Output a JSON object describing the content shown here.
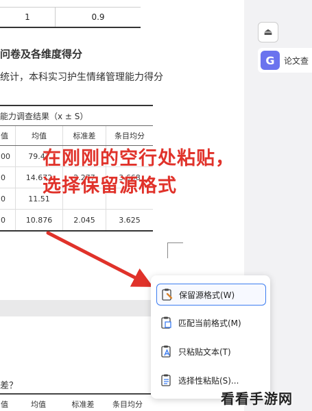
{
  "doc": {
    "top_table": [
      "1",
      "0.9"
    ],
    "heading": "问卷及各维度得分",
    "paragraph": "统计，本科实习护生情绪管理能力得分",
    "table_caption": "能力调查结果（x ± S）",
    "columns": [
      "值",
      "均值",
      "标准差",
      "条目均分"
    ],
    "rows": [
      [
        "00",
        "79.47",
        "",
        ""
      ],
      [
        "0",
        "14.672",
        "2.277",
        "3.668"
      ],
      [
        "0",
        "11.51",
        "",
        ""
      ],
      [
        "0",
        "10.876",
        "2.045",
        "3.625"
      ]
    ]
  },
  "annotation": {
    "line1": "在刚刚的空行处粘贴，",
    "line2": "选择保留源格式",
    "color": "#e0322a"
  },
  "bottom": {
    "title": "差？",
    "columns": [
      "值",
      "均值",
      "标准差",
      "条目均分"
    ]
  },
  "right_panel": {
    "collapse_icon": "⏏",
    "paper_logo": "G",
    "paper_label": "论文查"
  },
  "menu": {
    "items": [
      {
        "label": "保留源格式(W)",
        "icon": "clipboard-brush-icon",
        "selected": true
      },
      {
        "label": "匹配当前格式(M)",
        "icon": "clipboard-format-icon",
        "selected": false
      },
      {
        "label": "只粘贴文本(T)",
        "icon": "clipboard-text-icon",
        "selected": false
      },
      {
        "label": "选择性粘贴(S)...",
        "icon": "clipboard-list-icon",
        "selected": false
      }
    ]
  },
  "watermark": "看看手游网"
}
